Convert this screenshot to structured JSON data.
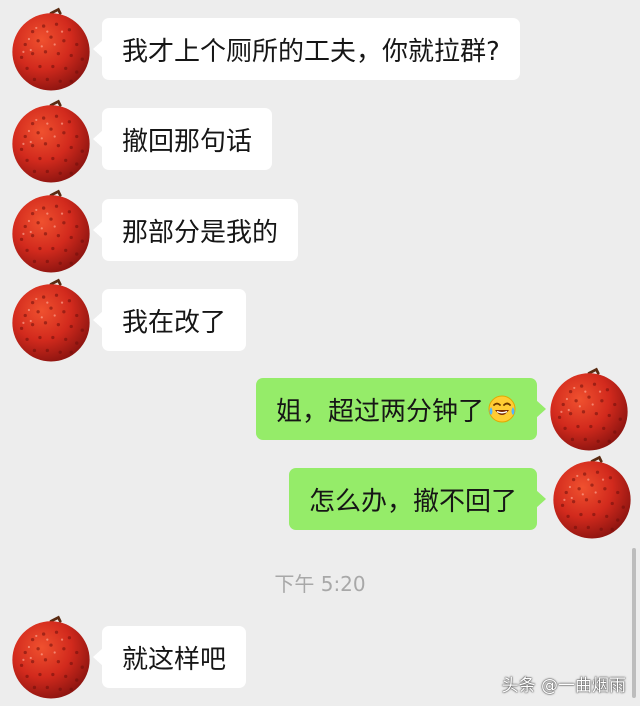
{
  "messages": [
    {
      "side": "left",
      "text": "我才上个厕所的工夫，你就拉群?"
    },
    {
      "side": "left",
      "text": "撤回那句话"
    },
    {
      "side": "left",
      "text": "那部分是我的"
    },
    {
      "side": "left",
      "text": "我在改了"
    },
    {
      "side": "right",
      "text": "姐，超过两分钟了",
      "emoji": "face-with-tears-of-joy-emoji"
    },
    {
      "side": "right",
      "text": "怎么办，撤不回了"
    },
    {
      "side": "left",
      "text": "就这样吧"
    }
  ],
  "timestamp": "下午 5:20",
  "watermark": "头条 @一曲烟雨",
  "avatar": "lychee-avatar",
  "colors": {
    "background": "#ededed",
    "bubble_left": "#ffffff",
    "bubble_right": "#95ec69",
    "timestamp": "#a8a8a8",
    "lychee": "#d6281c"
  }
}
